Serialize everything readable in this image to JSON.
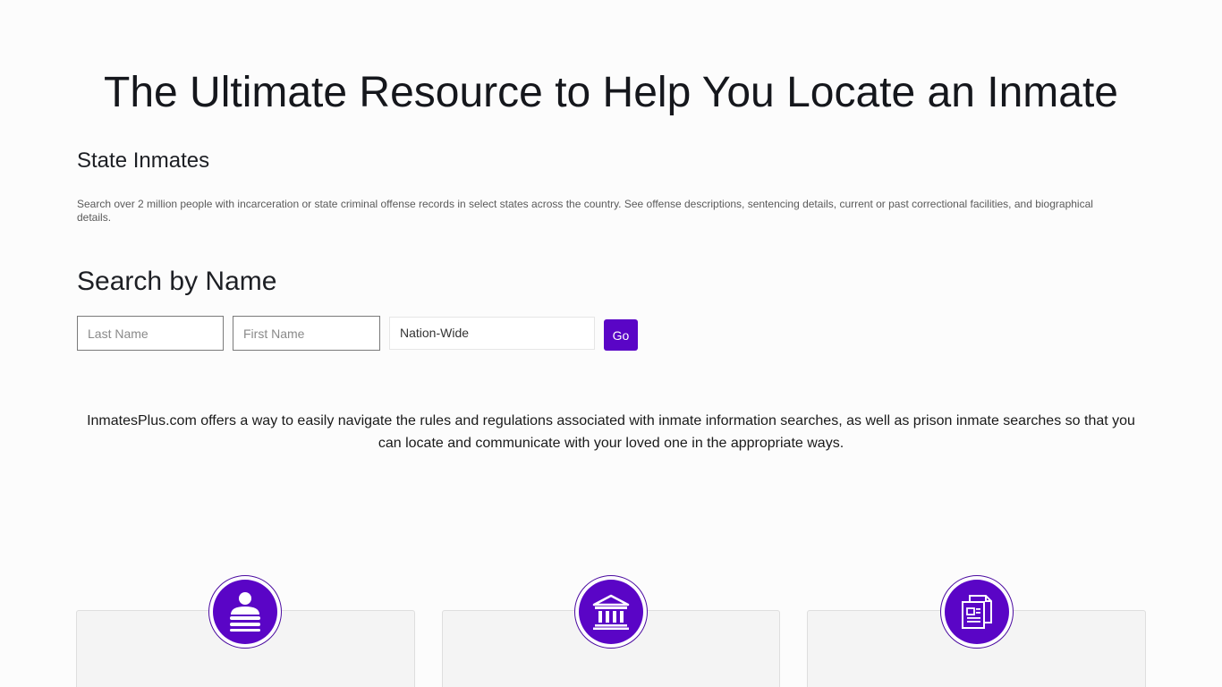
{
  "hero": {
    "title": "The Ultimate Resource to Help You Locate an Inmate"
  },
  "state_section": {
    "title": "State Inmates",
    "description": "Search over 2 million people with incarceration or state criminal offense records in select states across the country. See offense descriptions, sentencing details, current or past correctional facilities, and biographical details."
  },
  "search": {
    "title": "Search by Name",
    "last_name_placeholder": "Last Name",
    "first_name_placeholder": "First Name",
    "scope_value": "Nation-Wide",
    "go_label": "Go"
  },
  "intro": {
    "text": "InmatesPlus.com offers a way to easily navigate the rules and regulations associated with inmate information searches, as well as prison inmate searches so that you can locate and communicate with your loved one in the appropriate ways."
  },
  "cards": [
    {
      "icon": "inmate-person-icon"
    },
    {
      "icon": "courthouse-icon"
    },
    {
      "icon": "documents-icon"
    }
  ],
  "colors": {
    "accent": "#5a05c6",
    "background": "#fcfcfc",
    "card_background": "#f4f4f4"
  }
}
